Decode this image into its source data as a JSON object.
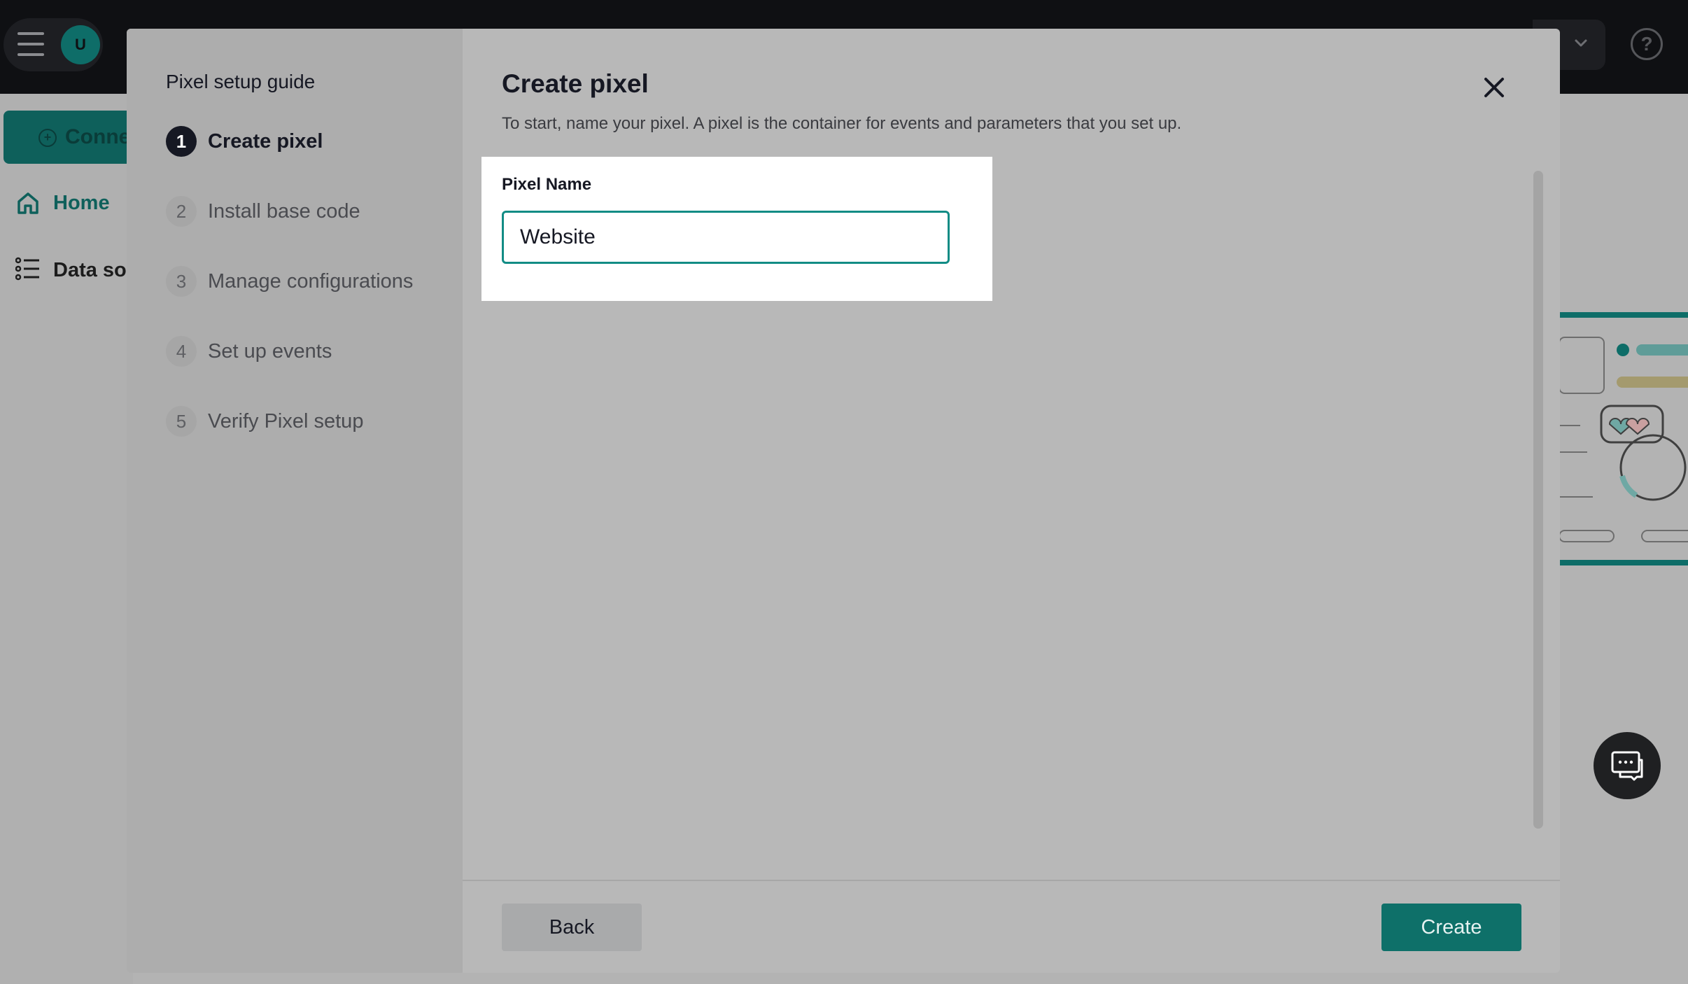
{
  "app": {
    "avatar_letter": "U",
    "connect_label": "Conne",
    "nav": {
      "home": "Home",
      "data_sources": "Data sou"
    }
  },
  "modal": {
    "guide_title": "Pixel setup guide",
    "steps": [
      {
        "num": "1",
        "label": "Create pixel",
        "active": true
      },
      {
        "num": "2",
        "label": "Install base code",
        "active": false
      },
      {
        "num": "3",
        "label": "Manage configurations",
        "active": false
      },
      {
        "num": "4",
        "label": "Set up events",
        "active": false
      },
      {
        "num": "5",
        "label": "Verify Pixel setup",
        "active": false
      }
    ],
    "title": "Create pixel",
    "subtitle": "To start, name your pixel. A pixel is the container for events and parameters that you set up.",
    "field_label": "Pixel Name",
    "field_value": "Website",
    "back_label": "Back",
    "create_label": "Create"
  },
  "colors": {
    "accent": "#0e7069",
    "focus_border": "#128c85",
    "overlay_bg": "#b3b3b3",
    "topbar": "#0f1013"
  },
  "icons": [
    "menu-icon",
    "chevron-down-icon",
    "help-icon",
    "home-icon",
    "list-icon",
    "close-icon",
    "chat-icon",
    "plus-circle-icon"
  ]
}
